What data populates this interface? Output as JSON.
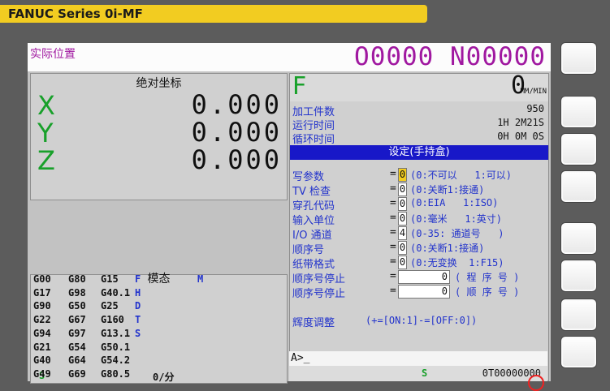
{
  "brand": {
    "text": "FANUC Series 0i-MF"
  },
  "screen": {
    "title": "实际位置",
    "program_number": "O0000 N00000"
  },
  "absolute": {
    "title": "绝对坐标",
    "axes": [
      {
        "name": "X",
        "value": "0.000"
      },
      {
        "name": "Y",
        "value": "0.000"
      },
      {
        "name": "Z",
        "value": "0.000"
      }
    ]
  },
  "modal": {
    "title": "模态",
    "rows": [
      [
        "G00",
        "G80",
        "G15",
        "F",
        ""
      ],
      [
        "G17",
        "G98",
        "G40.1",
        "H",
        ""
      ],
      [
        "G90",
        "G50",
        "G25",
        "D",
        ""
      ],
      [
        "G22",
        "G67",
        "G160",
        "T",
        ""
      ],
      [
        "G94",
        "G97",
        "G13.1",
        "S",
        ""
      ],
      [
        "G21",
        "G54",
        "G50.1",
        "",
        ""
      ],
      [
        "G40",
        "G64",
        "G54.2",
        "",
        ""
      ],
      [
        "G49",
        "G69",
        "G80.5",
        "",
        ""
      ]
    ],
    "m_label": "M",
    "spindle_label": "S",
    "spindle_value": "0/分"
  },
  "feed": {
    "label": "F",
    "value": "0",
    "unit": "MM/MIN"
  },
  "info": [
    {
      "label": "加工件数",
      "value": "950"
    },
    {
      "label": "运行时间",
      "value": "1H 2M21S"
    },
    {
      "label": "循环时间",
      "value": "0H 0M 0S"
    }
  ],
  "settings": {
    "header": "设定(手持盒)",
    "rows": [
      {
        "label": "写参数",
        "value": "0",
        "desc": "(0:不可以   1:可以)",
        "cursor": true
      },
      {
        "label": "TV  检查",
        "value": "0",
        "desc": "(0:关断1:接通)"
      },
      {
        "label": "穿孔代码",
        "value": "0",
        "desc": "(0:EIA   1:ISO)"
      },
      {
        "label": "输入单位",
        "value": "0",
        "desc": "(0:毫米   1:英寸)"
      },
      {
        "label": "I/O  通道",
        "value": "4",
        "desc": "(0-35: 通道号   )"
      },
      {
        "label": "顺序号",
        "value": "0",
        "desc": "(0:关断1:接通)"
      },
      {
        "label": "纸带格式",
        "value": "0",
        "desc": "(0:无变换  1:F15)"
      },
      {
        "label": "顺序号停止",
        "value": "0",
        "desc": "( 程 序 号 )",
        "wide": true
      },
      {
        "label": "顺序号停止",
        "value": "0",
        "desc": "( 顺 序 号 )",
        "wide": true
      }
    ],
    "brightness_label": "辉度调整",
    "brightness_desc": "(+=[ON:1]-=[OFF:0])"
  },
  "input_line": "A>_",
  "status": {
    "s_label": "S",
    "t_value": "0T00000000"
  }
}
